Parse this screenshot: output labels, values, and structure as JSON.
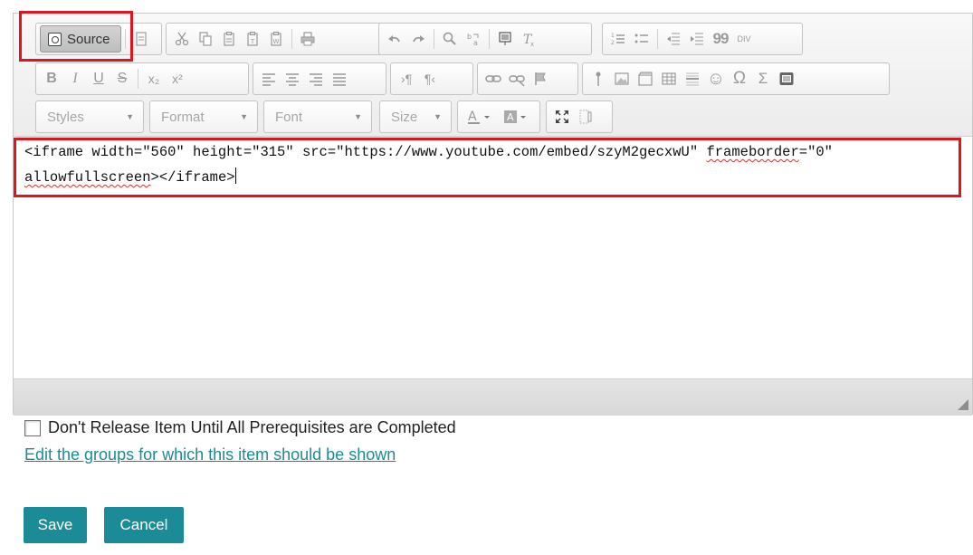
{
  "toolbar": {
    "source_label": "Source",
    "combos": {
      "styles": "Styles",
      "format": "Format",
      "font": "Font",
      "size": "Size"
    },
    "format_buttons": {
      "bold": "B",
      "italic": "I",
      "underline": "U",
      "strike": "S",
      "subscript": "x₂",
      "superscript": "x²"
    },
    "misc_glyphs": {
      "blockquote": "99",
      "div": "DIV",
      "omega": "Ω",
      "sigma": "Σ",
      "smiley": "☺"
    }
  },
  "editor": {
    "code_line_1_a": "<iframe width=\"560\" height=\"315\" src=\"https://www.youtube.com/embed/szyM2gecxwU\" ",
    "code_line_1_b": "frameborder",
    "code_line_1_c": "=\"0\"",
    "code_line_2_a": "allowfullscreen",
    "code_line_2_b": "></iframe>"
  },
  "form": {
    "checkbox_label": "Don't Release Item Until All Prerequisites are Completed",
    "groups_link": "Edit the groups for which this item should be shown",
    "save_label": "Save",
    "cancel_label": "Cancel"
  },
  "colors": {
    "highlight": "#e0141c",
    "button": "#1b8c97",
    "link": "#1b8c97"
  }
}
